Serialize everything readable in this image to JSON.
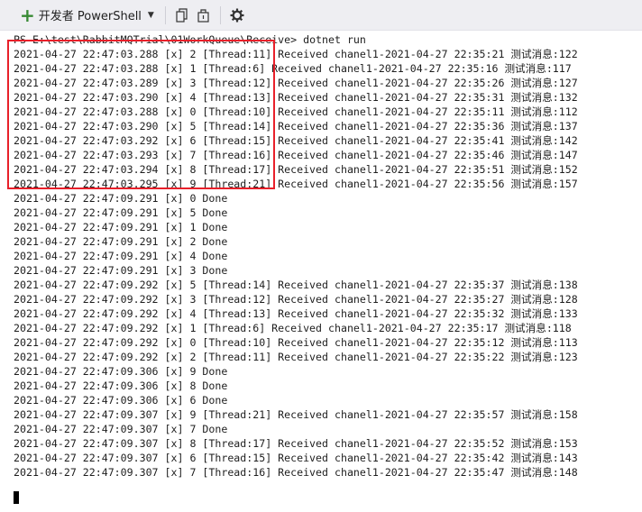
{
  "toolbar": {
    "developer_ps_label": "开发者 PowerShell",
    "buttons": [
      {
        "icon": "copy-icon"
      },
      {
        "icon": "window-icon"
      },
      {
        "icon": "gear-icon"
      }
    ]
  },
  "console": {
    "prompt": "PS E:\\test\\RabbitMQTrial\\01WorkQueue\\Receive> ",
    "command": "dotnet run",
    "lines": [
      "2021-04-27 22:47:03.288 [x] 2 [Thread:11] Received chanel1-2021-04-27 22:35:21 测试消息:122",
      "2021-04-27 22:47:03.288 [x] 1 [Thread:6] Received chanel1-2021-04-27 22:35:16 测试消息:117",
      "2021-04-27 22:47:03.289 [x] 3 [Thread:12] Received chanel1-2021-04-27 22:35:26 测试消息:127",
      "2021-04-27 22:47:03.290 [x] 4 [Thread:13] Received chanel1-2021-04-27 22:35:31 测试消息:132",
      "2021-04-27 22:47:03.288 [x] 0 [Thread:10] Received chanel1-2021-04-27 22:35:11 测试消息:112",
      "2021-04-27 22:47:03.290 [x] 5 [Thread:14] Received chanel1-2021-04-27 22:35:36 测试消息:137",
      "2021-04-27 22:47:03.292 [x] 6 [Thread:15] Received chanel1-2021-04-27 22:35:41 测试消息:142",
      "2021-04-27 22:47:03.293 [x] 7 [Thread:16] Received chanel1-2021-04-27 22:35:46 测试消息:147",
      "2021-04-27 22:47:03.294 [x] 8 [Thread:17] Received chanel1-2021-04-27 22:35:51 测试消息:152",
      "2021-04-27 22:47:03.295 [x] 9 [Thread:21] Received chanel1-2021-04-27 22:35:56 测试消息:157",
      "2021-04-27 22:47:09.291 [x] 0 Done",
      "2021-04-27 22:47:09.291 [x] 5 Done",
      "2021-04-27 22:47:09.291 [x] 1 Done",
      "2021-04-27 22:47:09.291 [x] 2 Done",
      "2021-04-27 22:47:09.291 [x] 4 Done",
      "2021-04-27 22:47:09.291 [x] 3 Done",
      "2021-04-27 22:47:09.292 [x] 5 [Thread:14] Received chanel1-2021-04-27 22:35:37 测试消息:138",
      "2021-04-27 22:47:09.292 [x] 3 [Thread:12] Received chanel1-2021-04-27 22:35:27 测试消息:128",
      "2021-04-27 22:47:09.292 [x] 4 [Thread:13] Received chanel1-2021-04-27 22:35:32 测试消息:133",
      "2021-04-27 22:47:09.292 [x] 1 [Thread:6] Received chanel1-2021-04-27 22:35:17 测试消息:118",
      "2021-04-27 22:47:09.292 [x] 0 [Thread:10] Received chanel1-2021-04-27 22:35:12 测试消息:113",
      "2021-04-27 22:47:09.292 [x] 2 [Thread:11] Received chanel1-2021-04-27 22:35:22 测试消息:123",
      "2021-04-27 22:47:09.306 [x] 9 Done",
      "2021-04-27 22:47:09.306 [x] 8 Done",
      "2021-04-27 22:47:09.306 [x] 6 Done",
      "2021-04-27 22:47:09.307 [x] 9 [Thread:21] Received chanel1-2021-04-27 22:35:57 测试消息:158",
      "2021-04-27 22:47:09.307 [x] 7 Done",
      "2021-04-27 22:47:09.307 [x] 8 [Thread:17] Received chanel1-2021-04-27 22:35:52 测试消息:153",
      "2021-04-27 22:47:09.307 [x] 6 [Thread:15] Received chanel1-2021-04-27 22:35:42 测试消息:143",
      "2021-04-27 22:47:09.307 [x] 7 [Thread:16] Received chanel1-2021-04-27 22:35:47 测试消息:148"
    ]
  },
  "colors": {
    "toolbar_bg": "#eeeef2",
    "plus_green": "#388a34",
    "highlight_red": "#e8202a",
    "text": "#1e1e1e"
  }
}
